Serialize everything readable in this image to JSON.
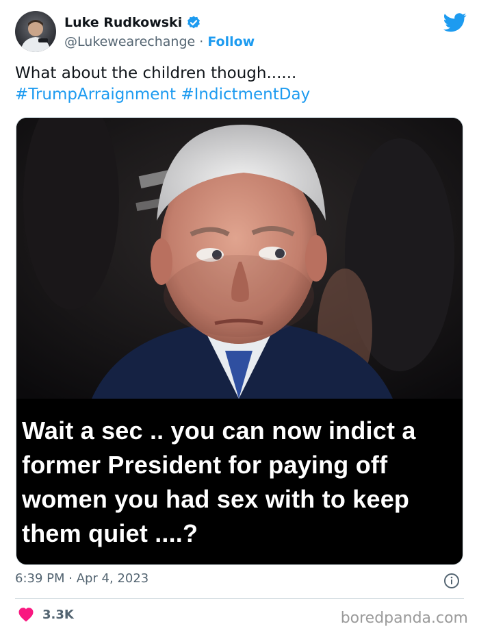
{
  "tweet": {
    "author_name": "Luke Rudkowski",
    "author_handle": "@Lukewearechange",
    "separator": " · ",
    "follow_label": "Follow",
    "text": "What about the children though......",
    "hashtags": [
      "#TrumpArraignment",
      "#IndictmentDay"
    ],
    "timestamp": "6:39 PM · Apr 4, 2023",
    "like_count": "3.3K"
  },
  "media": {
    "caption_lines": [
      "Wait a sec .. you can now indict a",
      "former President for paying off",
      "women you had sex with to keep",
      "them quiet ....?"
    ]
  },
  "watermark": "boredpanda.com",
  "icons": {
    "verified": "verified-badge-icon",
    "bird": "twitter-bird-icon",
    "info": "info-icon",
    "like": "heart-icon"
  },
  "colors": {
    "accent": "#1d9bf0",
    "like": "#f91880",
    "secondary_text": "#536471"
  }
}
